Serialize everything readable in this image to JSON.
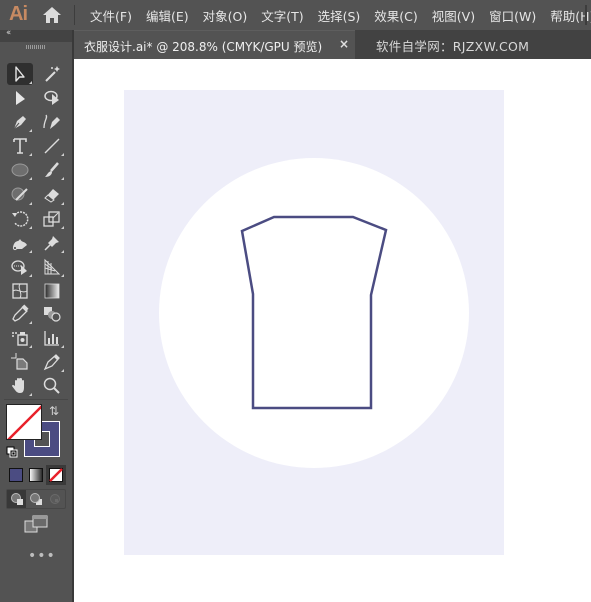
{
  "app": {
    "logo": "Ai",
    "brand_color": "#c78a62"
  },
  "menu": {
    "items": [
      {
        "label": "文件(F)"
      },
      {
        "label": "编辑(E)"
      },
      {
        "label": "对象(O)"
      },
      {
        "label": "文字(T)"
      },
      {
        "label": "选择(S)"
      },
      {
        "label": "效果(C)"
      },
      {
        "label": "视图(V)"
      },
      {
        "label": "窗口(W)"
      },
      {
        "label": "帮助(H)"
      }
    ]
  },
  "toolbar": {
    "collapse_glyph": "‹‹",
    "more_glyph": "•••",
    "swap_glyph": "⇅",
    "tools": [
      {
        "name": "selection-tool",
        "icon": "selection-arrow-icon",
        "active": true
      },
      {
        "name": "magic-wand-tool",
        "icon": "magic-wand-icon"
      },
      {
        "name": "direct-selection-tool",
        "icon": "direct-selection-icon"
      },
      {
        "name": "lasso-tool",
        "icon": "lasso-icon"
      },
      {
        "name": "pen-tool",
        "icon": "pen-icon"
      },
      {
        "name": "curvature-tool",
        "icon": "curvature-icon"
      },
      {
        "name": "type-tool",
        "icon": "type-icon"
      },
      {
        "name": "line-segment-tool",
        "icon": "line-icon"
      },
      {
        "name": "ellipse-tool",
        "icon": "ellipse-icon"
      },
      {
        "name": "paintbrush-tool",
        "icon": "paintbrush-icon"
      },
      {
        "name": "shaper-tool",
        "icon": "shaper-icon"
      },
      {
        "name": "eraser-tool",
        "icon": "eraser-icon"
      },
      {
        "name": "rotate-tool",
        "icon": "rotate-icon"
      },
      {
        "name": "scale-tool",
        "icon": "scale-icon"
      },
      {
        "name": "puppet-warp-tool",
        "icon": "puppet-warp-icon"
      },
      {
        "name": "pin-tool",
        "icon": "pin-icon"
      },
      {
        "name": "shape-builder-tool",
        "icon": "shape-builder-icon"
      },
      {
        "name": "perspective-grid-tool",
        "icon": "perspective-grid-icon"
      },
      {
        "name": "mesh-tool",
        "icon": "mesh-icon"
      },
      {
        "name": "gradient-tool",
        "icon": "gradient-icon"
      },
      {
        "name": "eyedropper-tool",
        "icon": "eyedropper-icon"
      },
      {
        "name": "blend-tool",
        "icon": "blend-icon"
      },
      {
        "name": "symbol-sprayer-tool",
        "icon": "symbol-sprayer-icon"
      },
      {
        "name": "column-graph-tool",
        "icon": "column-graph-icon"
      },
      {
        "name": "artboard-tool",
        "icon": "artboard-icon"
      },
      {
        "name": "slice-tool",
        "icon": "slice-icon"
      },
      {
        "name": "hand-tool",
        "icon": "hand-icon"
      },
      {
        "name": "zoom-tool",
        "icon": "zoom-icon"
      }
    ],
    "fill": {
      "state": "none",
      "none_color": "#e8202a"
    },
    "stroke": {
      "color": "#4b4c82"
    },
    "color_modes": [
      {
        "name": "color",
        "swatch": "#4b4c82"
      },
      {
        "name": "gradient"
      },
      {
        "name": "none",
        "active": true
      }
    ],
    "draw_modes": [
      {
        "name": "draw-normal",
        "active": true
      },
      {
        "name": "draw-behind"
      },
      {
        "name": "draw-inside"
      }
    ]
  },
  "tabs": {
    "document": "衣服设计.ai* @ 208.8% (CMYK/GPU 预览)",
    "close_glyph": "×",
    "other": "软件自学网：RJZXW.COM"
  },
  "artwork": {
    "artboard_color": "#eeeef9",
    "circle_color": "#ffffff",
    "shirt_stroke": "#4b4c82",
    "shirt_fill": "#ffffff"
  }
}
